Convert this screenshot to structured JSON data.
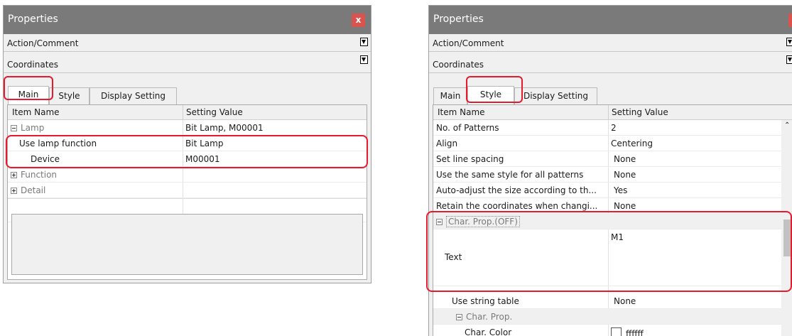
{
  "left_panel": {
    "title": "Properties",
    "close": "x",
    "sections": [
      "Action/Comment",
      "Coordinates"
    ],
    "tabs": [
      "Main",
      "Style",
      "Display Setting"
    ],
    "columns": [
      "Item Name",
      "Setting Value"
    ],
    "rows": [
      {
        "name": "Lamp",
        "value": "Bit Lamp, M00001"
      },
      {
        "name": "Use lamp function",
        "value": "Bit Lamp"
      },
      {
        "name": "Device",
        "value": "M00001"
      },
      {
        "name": "Function",
        "value": ""
      },
      {
        "name": "Detail",
        "value": ""
      }
    ]
  },
  "right_panel": {
    "title": "Properties",
    "close": "x",
    "sections": [
      "Action/Comment",
      "Coordinates"
    ],
    "tabs": [
      "Main",
      "Style",
      "Display Setting"
    ],
    "columns": [
      "Item Name",
      "Setting Value"
    ],
    "rows": [
      {
        "name": "No. of Patterns",
        "value": "2"
      },
      {
        "name": "Align",
        "value": "Centering"
      },
      {
        "name": "Set line spacing",
        "value": "None"
      },
      {
        "name": "Use the same style for all patterns",
        "value": "None"
      },
      {
        "name": "Auto-adjust the size according to th...",
        "value": "Yes"
      },
      {
        "name": "Retain the coordinates when changi...",
        "value": "None"
      },
      {
        "name": "Char. Prop.(OFF)",
        "value": ""
      },
      {
        "name": "Text",
        "value": "M1"
      },
      {
        "name": "Use string table",
        "value": "None"
      },
      {
        "name": "Char. Prop.",
        "value": ""
      },
      {
        "name": "Char. Color",
        "value": "ffffff"
      }
    ]
  },
  "colors": {
    "highlight": "#e8192c",
    "titlebar": "#7a7a7a",
    "close": "#d9534f"
  }
}
